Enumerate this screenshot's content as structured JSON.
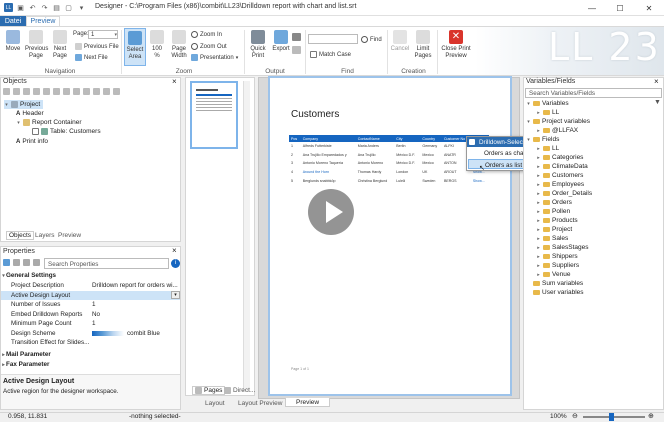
{
  "titlebar": {
    "title": "Designer - C:\\Program Files (x86)\\combit\\LL23\\Drilldown report with chart and list.srt",
    "minimize": "—",
    "maximize": "☐",
    "close": "✕"
  },
  "tabs": [
    {
      "label": "Datei"
    },
    {
      "label": "Preview"
    }
  ],
  "ribbon": {
    "move": "Move",
    "prev_page": "Previous\nPage",
    "next_page": "Next\nPage",
    "page_label": "Page:",
    "page_value": "1",
    "prev_file": "Previous File",
    "next_file": "Next File",
    "select_area": "Select\nArea",
    "zoom100": "100\n%",
    "page_width": "Page\nWidth",
    "zoom_in": "Zoom In",
    "zoom_out": "Zoom Out",
    "presentation": "Presentation",
    "quick_print": "Quick\nPrint",
    "export": "Export",
    "match_case": "Match Case",
    "find": "Find",
    "cancel": "Cancel",
    "limit_pages": "Limit\nPages",
    "close_preview": "Close Print\nPreview",
    "groups": {
      "navigation": "Navigation",
      "zoom": "Zoom",
      "output": "Output",
      "find": "Find",
      "creation": "Creation"
    },
    "logo": "LL 23"
  },
  "objects": {
    "title": "Objects",
    "items": [
      {
        "label": "Project"
      },
      {
        "label": "Header"
      },
      {
        "label": "Report Container"
      },
      {
        "label": "Table: Customers"
      },
      {
        "label": "Print info"
      }
    ],
    "tabs": [
      {
        "label": "Objects"
      },
      {
        "label": "Layers"
      },
      {
        "label": "Preview"
      }
    ]
  },
  "properties": {
    "title": "Properties",
    "search_placeholder": "Search Properties",
    "group_general": "General Settings",
    "rows": [
      {
        "key": "Project Description",
        "value": "Drilldown report for orders wi..."
      },
      {
        "key": "Active Design Layout",
        "value": ""
      },
      {
        "key": "Number of Issues",
        "value": "1"
      },
      {
        "key": "Embed Drilldown Reports",
        "value": "No"
      },
      {
        "key": "Minimum Page Count",
        "value": "1"
      },
      {
        "key": "Design Scheme",
        "value": "combit Blue"
      },
      {
        "key": "Transition Effect for Slides...",
        "value": ""
      }
    ],
    "group_mail": "Mail Parameter",
    "group_fax": "Fax Parameter",
    "help_title": "Active Design Layout",
    "help_text": "Active region for the designer workspace."
  },
  "thumbs": {
    "tabs": [
      {
        "label": "Pages"
      },
      {
        "label": "Direct..."
      }
    ]
  },
  "preview": {
    "heading": "Customers",
    "columns": [
      "Pos",
      "Company",
      "ContactName",
      "City",
      "Country",
      "Customer No",
      "Orders"
    ],
    "rows": [
      [
        "1",
        "Alfreds Futterkiste",
        "Maria Anders",
        "Berlin",
        "Germany",
        "ALFKI",
        "Show..."
      ],
      [
        "2",
        "Ana Trujillo Emparedados y",
        "Ana Trujillo",
        "México D.F.",
        "Mexico",
        "ANATR",
        "Show..."
      ],
      [
        "3",
        "Antonio Moreno Taquería",
        "Antonio Moreno",
        "México D.F.",
        "Mexico",
        "ANTON",
        "Show..."
      ],
      [
        "4",
        "Around the Horn",
        "Thomas Hardy",
        "London",
        "UK",
        "AROUT",
        "Show..."
      ],
      [
        "5",
        "Berglunds snabbköp",
        "Christina Berglund",
        "Luleå",
        "Sweden",
        "BERGS",
        "Show..."
      ]
    ],
    "page_footer": "Page 1 of 1",
    "context_menu": {
      "title": "Drilldown-Selection",
      "items": [
        {
          "label": "Orders as chart"
        },
        {
          "label": "Orders as list"
        }
      ]
    },
    "bottom_tabs": [
      {
        "label": "Layout"
      },
      {
        "label": "Layout Preview"
      },
      {
        "label": "Preview"
      }
    ]
  },
  "variables": {
    "title": "Variables/Fields",
    "search_placeholder": "Search Variables/Fields",
    "items": [
      {
        "label": "Variables",
        "level": 0
      },
      {
        "label": "LL",
        "level": 1
      },
      {
        "label": "Project variables",
        "level": 0
      },
      {
        "label": "@LLFAX",
        "level": 1
      },
      {
        "label": "Fields",
        "level": 0
      },
      {
        "label": "LL",
        "level": 1
      },
      {
        "label": "Categories",
        "level": 1
      },
      {
        "label": "ClimateData",
        "level": 1
      },
      {
        "label": "Customers",
        "level": 1
      },
      {
        "label": "Employees",
        "level": 1
      },
      {
        "label": "Order_Details",
        "level": 1
      },
      {
        "label": "Orders",
        "level": 1
      },
      {
        "label": "Pollen",
        "level": 1
      },
      {
        "label": "Products",
        "level": 1
      },
      {
        "label": "Project",
        "level": 1
      },
      {
        "label": "Sales",
        "level": 1
      },
      {
        "label": "SalesStages",
        "level": 1
      },
      {
        "label": "Shippers",
        "level": 1
      },
      {
        "label": "Suppliers",
        "level": 1
      },
      {
        "label": "Venue",
        "level": 1
      },
      {
        "label": "Sum variables",
        "level": 0
      },
      {
        "label": "User variables",
        "level": 0
      }
    ]
  },
  "status": {
    "coords": "0.958, 11.831",
    "selection": "-nothing selected-",
    "zoom": "100%"
  },
  "colors": {
    "accent": "#1565c0",
    "tab_active": "#2b6cb0",
    "folder": "#e8b94a"
  }
}
